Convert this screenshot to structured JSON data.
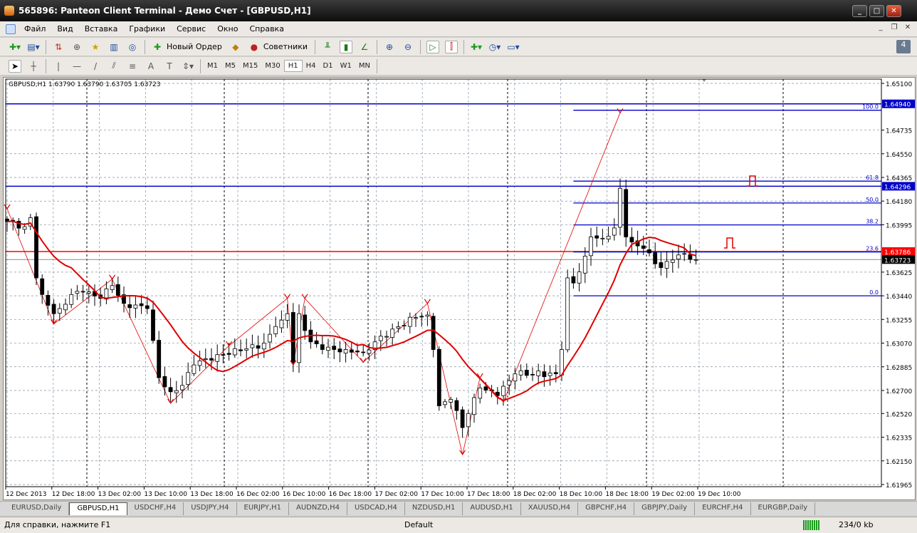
{
  "window": {
    "title": "565896: Panteon Client Terminal - Демо Счет - [GBPUSD,H1]"
  },
  "menu": [
    "Файл",
    "Вид",
    "Вставка",
    "Графики",
    "Сервис",
    "Окно",
    "Справка"
  ],
  "toolbar": {
    "new_order": "Новый Ордер",
    "experts": "Советники"
  },
  "timeframes": [
    "M1",
    "M5",
    "M15",
    "M30",
    "H1",
    "H4",
    "D1",
    "W1",
    "MN"
  ],
  "active_timeframe": "H1",
  "chart_header": "GBPUSD,H1  1.63790 1.63790 1.63705 1.63723",
  "tabs": [
    "EURUSD,Daily",
    "GBPUSD,H1",
    "USDCHF,H4",
    "USDJPY,H4",
    "EURJPY,H1",
    "AUDNZD,H4",
    "USDCAD,H4",
    "NZDUSD,H1",
    "AUDUSD,H1",
    "XAUUSD,H4",
    "GBPCHF,H4",
    "GBPJPY,Daily",
    "EURCHF,H4",
    "EURGBP,Daily"
  ],
  "active_tab": "GBPUSD,H1",
  "status": {
    "help": "Для справки, нажмите F1",
    "profile": "Default",
    "traffic": "234/0 kb"
  },
  "chart_data": {
    "type": "candlestick",
    "symbol": "GBPUSD",
    "timeframe": "H1",
    "ylim": [
      1.61965,
      1.651
    ],
    "y_ticks": [
      "1.65100",
      "1.64735",
      "1.64550",
      "1.64365",
      "1.64180",
      "1.63995",
      "1.63625",
      "1.63440",
      "1.63255",
      "1.63070",
      "1.62885",
      "1.62700",
      "1.62520",
      "1.62335",
      "1.62150",
      "1.61965"
    ],
    "x_ticks": [
      "12 Dec 2013",
      "12 Dec 18:00",
      "13 Dec 02:00",
      "13 Dec 10:00",
      "13 Dec 18:00",
      "16 Dec 02:00",
      "16 Dec 10:00",
      "16 Dec 18:00",
      "17 Dec 02:00",
      "17 Dec 10:00",
      "17 Dec 18:00",
      "18 Dec 02:00",
      "18 Dec 10:00",
      "18 Dec 18:00",
      "19 Dec 02:00",
      "19 Dec 10:00"
    ],
    "bar_count": 119,
    "close_keypoints": [
      [
        0,
        1.6402
      ],
      [
        3,
        1.6398
      ],
      [
        4,
        1.6405
      ],
      [
        5,
        1.6358
      ],
      [
        6,
        1.6345
      ],
      [
        8,
        1.633
      ],
      [
        9,
        1.6334
      ],
      [
        11,
        1.6345
      ],
      [
        13,
        1.6347
      ],
      [
        16,
        1.6342
      ],
      [
        18,
        1.6352
      ],
      [
        20,
        1.6338
      ],
      [
        24,
        1.6334
      ],
      [
        26,
        1.628
      ],
      [
        28,
        1.6269
      ],
      [
        30,
        1.6274
      ],
      [
        32,
        1.629
      ],
      [
        36,
        1.6298
      ],
      [
        40,
        1.6301
      ],
      [
        44,
        1.6307
      ],
      [
        46,
        1.632
      ],
      [
        47,
        1.6325
      ],
      [
        48,
        1.633
      ],
      [
        49,
        1.6292
      ],
      [
        50,
        1.633
      ],
      [
        52,
        1.6308
      ],
      [
        54,
        1.6302
      ],
      [
        58,
        1.6302
      ],
      [
        61,
        1.63
      ],
      [
        63,
        1.6308
      ],
      [
        66,
        1.6318
      ],
      [
        70,
        1.6327
      ],
      [
        72,
        1.6329
      ],
      [
        73,
        1.6302
      ],
      [
        74,
        1.6258
      ],
      [
        76,
        1.6263
      ],
      [
        78,
        1.6241
      ],
      [
        79,
        1.6252
      ],
      [
        81,
        1.6272
      ],
      [
        84,
        1.6266
      ],
      [
        87,
        1.6283
      ],
      [
        94,
        1.6283
      ],
      [
        95,
        1.6302
      ],
      [
        96,
        1.6358
      ],
      [
        97,
        1.6354
      ],
      [
        99,
        1.6375
      ],
      [
        100,
        1.639
      ],
      [
        102,
        1.6389
      ],
      [
        104,
        1.6397
      ],
      [
        105,
        1.6428
      ],
      [
        106,
        1.639
      ],
      [
        107,
        1.6386
      ],
      [
        109,
        1.6381
      ],
      [
        111,
        1.6369
      ],
      [
        112,
        1.6366
      ],
      [
        114,
        1.6372
      ],
      [
        116,
        1.6377
      ],
      [
        118,
        1.63723
      ]
    ],
    "zigzag": [
      [
        0,
        1.6412
      ],
      [
        8,
        1.6322
      ],
      [
        18,
        1.6357
      ],
      [
        28,
        1.626
      ],
      [
        38,
        1.6305
      ],
      [
        48,
        1.6342
      ],
      [
        49,
        1.629
      ],
      [
        51,
        1.6342
      ],
      [
        61,
        1.6292
      ],
      [
        72,
        1.6338
      ],
      [
        78,
        1.622
      ],
      [
        81,
        1.628
      ],
      [
        85,
        1.6261
      ],
      [
        105,
        1.6487
      ]
    ],
    "horizontal_lines": [
      {
        "price": "1.64940",
        "color": "#0000c8"
      },
      {
        "price": "1.64296",
        "color": "#0000c8"
      },
      {
        "price": "1.63786",
        "color": "#ff0000"
      },
      {
        "price": "1.63723",
        "color": "#000000"
      }
    ],
    "fibonacci": {
      "from": 1.6344,
      "to": 1.6489,
      "start_bar": 97,
      "levels": [
        {
          "label": "100.0",
          "ratio": 1
        },
        {
          "label": "61.8",
          "ratio": 0.618
        },
        {
          "label": "50.0",
          "ratio": 0.5
        },
        {
          "label": "38.2",
          "ratio": 0.382
        },
        {
          "label": "23.6",
          "ratio": 0.236
        },
        {
          "label": "0.0",
          "ratio": 0
        }
      ]
    },
    "ma_period": 12,
    "colors": {
      "ma": "#e00000",
      "bull": "#ffffff",
      "bear": "#000000",
      "grid": "#8090a0"
    }
  }
}
